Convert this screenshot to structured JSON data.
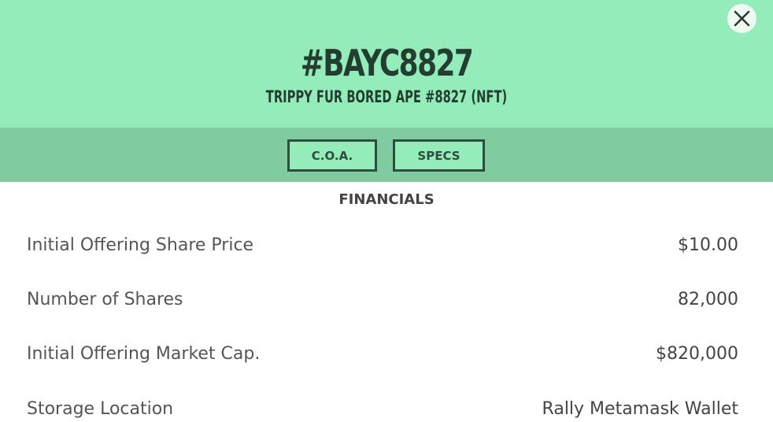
{
  "header": {
    "title": "#BAYC8827",
    "subtitle": "TRIPPY FUR BORED APE #8827 (NFT)",
    "close_icon": "close-icon"
  },
  "tabs": [
    {
      "label": "C.O.A."
    },
    {
      "label": "SPECS"
    }
  ],
  "financials": {
    "heading": "FINANCIALS",
    "rows": [
      {
        "label": "Initial Offering Share Price",
        "value": "$10.00"
      },
      {
        "label": "Number of Shares",
        "value": "82,000"
      },
      {
        "label": "Initial Offering Market Cap.",
        "value": "$820,000"
      },
      {
        "label": "Storage Location",
        "value": "Rally Metamask Wallet"
      }
    ]
  },
  "colors": {
    "header_bg": "#95ecbb",
    "tabbar_bg": "#80cb9f",
    "dark_green": "#233e30",
    "text_gray": "#555555"
  }
}
